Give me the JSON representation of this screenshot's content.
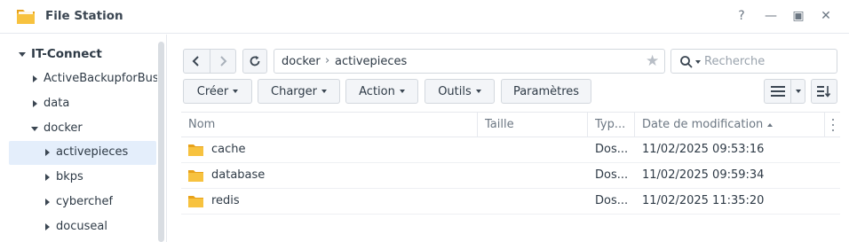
{
  "window": {
    "title": "File Station",
    "app_icon": "folder-icon"
  },
  "window_controls": {
    "help": "?",
    "minimize": "—",
    "maximize": "▣",
    "close": "✕"
  },
  "sidebar": {
    "root": {
      "label": "IT-Connect",
      "expanded": true
    },
    "items": [
      {
        "label": "ActiveBackupforBus",
        "expanded": false,
        "level": 1
      },
      {
        "label": "data",
        "expanded": false,
        "level": 1
      },
      {
        "label": "docker",
        "expanded": true,
        "level": 1
      },
      {
        "label": "activepieces",
        "expanded": false,
        "level": 2,
        "selected": true
      },
      {
        "label": "bkps",
        "expanded": false,
        "level": 2
      },
      {
        "label": "cyberchef",
        "expanded": false,
        "level": 2
      },
      {
        "label": "docuseal",
        "expanded": false,
        "level": 2
      }
    ]
  },
  "path": {
    "segments": [
      "docker",
      "activepieces"
    ],
    "separator": "›"
  },
  "search": {
    "placeholder": "Recherche",
    "value": ""
  },
  "toolbar": {
    "create": "Créer",
    "upload": "Charger",
    "action": "Action",
    "tools": "Outils",
    "settings": "Paramètres"
  },
  "table": {
    "columns": {
      "name": "Nom",
      "size": "Taille",
      "type": "Typ...",
      "modified": "Date de modification"
    },
    "rows": [
      {
        "name": "cache",
        "size": "",
        "type": "Dos...",
        "modified": "11/02/2025 09:53:16"
      },
      {
        "name": "database",
        "size": "",
        "type": "Dos...",
        "modified": "11/02/2025 09:59:34"
      },
      {
        "name": "redis",
        "size": "",
        "type": "Dos...",
        "modified": "11/02/2025 11:35:20"
      }
    ]
  },
  "colors": {
    "accent": "#e4eefb",
    "folder": "#f7c23f",
    "border": "#d3d8de"
  }
}
